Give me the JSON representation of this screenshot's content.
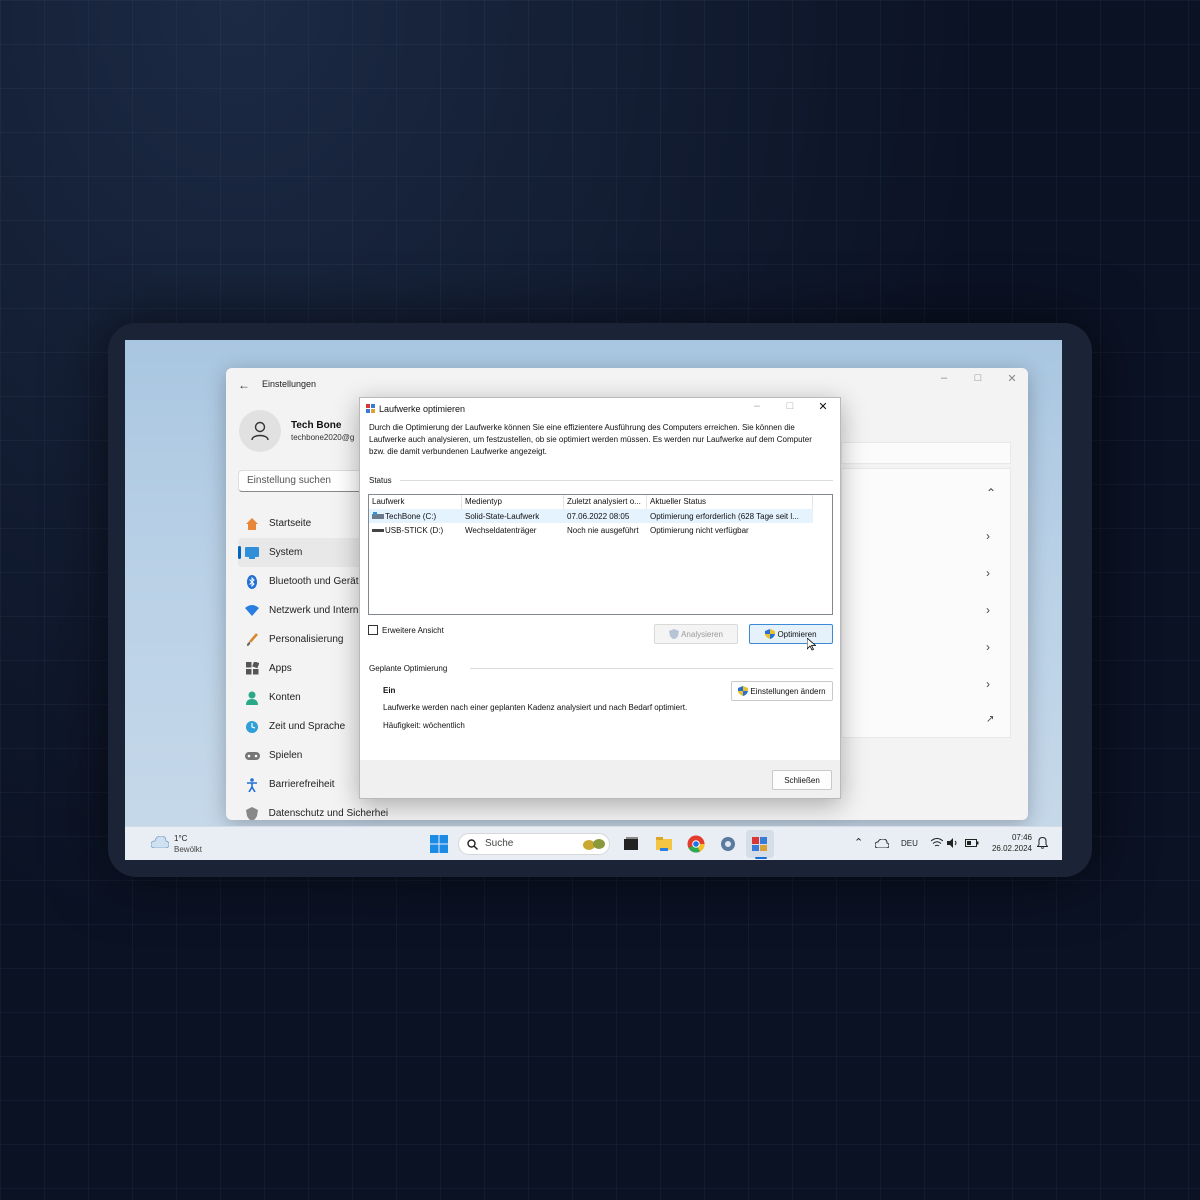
{
  "settings": {
    "title": "Einstellungen",
    "user": {
      "name": "Tech Bone",
      "email": "techbone2020@g"
    },
    "search_placeholder": "Einstellung suchen",
    "nav": [
      {
        "label": "Startseite",
        "icon": "home-icon"
      },
      {
        "label": "System",
        "icon": "system-icon",
        "active": true
      },
      {
        "label": "Bluetooth und Gerät",
        "icon": "bluetooth-icon"
      },
      {
        "label": "Netzwerk und Intern",
        "icon": "wifi-icon"
      },
      {
        "label": "Personalisierung",
        "icon": "brush-icon"
      },
      {
        "label": "Apps",
        "icon": "apps-icon"
      },
      {
        "label": "Konten",
        "icon": "account-icon"
      },
      {
        "label": "Zeit und Sprache",
        "icon": "globe-clock-icon"
      },
      {
        "label": "Spielen",
        "icon": "gamepad-icon"
      },
      {
        "label": "Barrierefreiheit",
        "icon": "accessibility-icon"
      },
      {
        "label": "Datenschutz und Sicherheit",
        "icon": "shield-icon"
      }
    ]
  },
  "dialog": {
    "title": "Laufwerke optimieren",
    "description": "Durch die Optimierung der Laufwerke können Sie eine effizientere Ausführung des Computers erreichen. Sie können die Laufwerke auch analysieren, um festzustellen, ob sie optimiert werden müssen. Es werden nur Laufwerke auf dem Computer bzw. die damit verbundenen Laufwerke angezeigt.",
    "status_label": "Status",
    "columns": [
      "Laufwerk",
      "Medientyp",
      "Zuletzt analysiert o...",
      "Aktueller Status"
    ],
    "drives": [
      {
        "name": "TechBone (C:)",
        "media": "Solid-State-Laufwerk",
        "last": "07.06.2022 08:05",
        "status": "Optimierung erforderlich (628 Tage seit l..."
      },
      {
        "name": "USB-STICK (D:)",
        "media": "Wechseldatenträger",
        "last": "Noch nie ausgeführt",
        "status": "Optimierung nicht verfügbar"
      }
    ],
    "advanced_view_label": "Erweitere Ansicht",
    "analyze_label": "Analysieren",
    "optimize_label": "Optimieren",
    "scheduled_label": "Geplante Optimierung",
    "scheduled_state": "Ein",
    "scheduled_desc": "Laufwerke werden nach einer geplanten Kadenz analysiert und nach Bedarf optimiert.",
    "frequency": "Häufigkeit: wöchentlich",
    "change_settings_label": "Einstellungen ändern",
    "close_label": "Schließen"
  },
  "taskbar": {
    "weather_temp": "1°C",
    "weather_desc": "Bewölkt",
    "search_placeholder": "Suche",
    "language": "DEU",
    "time": "07:46",
    "date": "26.02.2024"
  }
}
